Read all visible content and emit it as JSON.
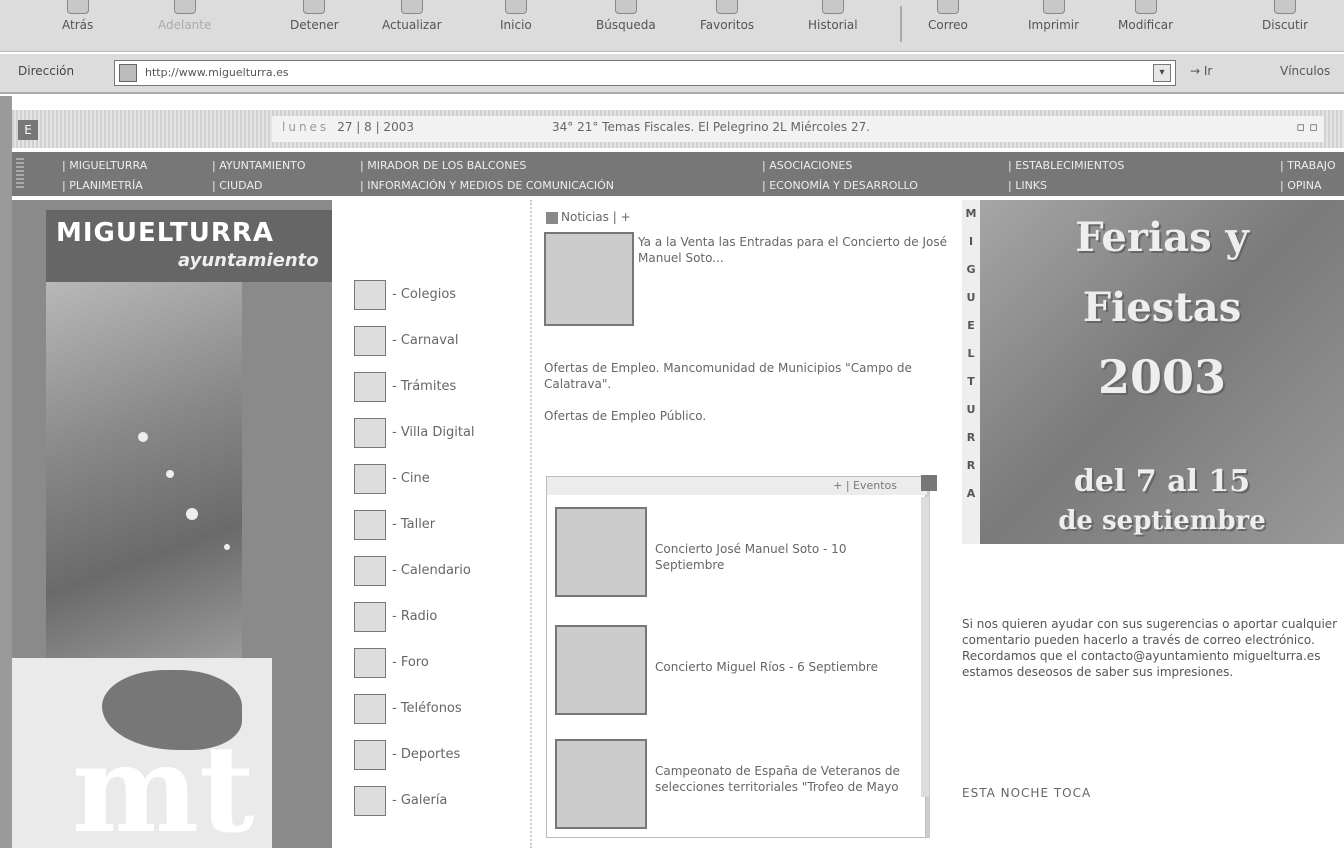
{
  "toolbar": {
    "buttons": [
      "Atrás",
      "Adelante",
      "Detener",
      "Actualizar",
      "Inicio",
      "Búsqueda",
      "Favoritos",
      "Historial",
      "Correo",
      "Imprimir",
      "Modificar",
      "Discutir"
    ]
  },
  "address": {
    "label": "Dirección",
    "url": "http://www.miguelturra.es",
    "go": "Ir",
    "links": "Vínculos"
  },
  "datebar": {
    "day": "lunes",
    "date": "27 | 8 | 2003",
    "weather": "34°  21°  Temas Fiscales. El Pelegrino 2L Miércoles 27."
  },
  "nav": {
    "row1": [
      "| MIGUELTURRA",
      "| AYUNTAMIENTO",
      "| MIRADOR DE LOS BALCONES",
      "| ASOCIACIONES",
      "| ESTABLECIMIENTOS",
      "| TRABAJO"
    ],
    "row2": [
      "| PLANIMETRÍA",
      "| CIUDAD",
      "| INFORMACIÓN Y MEDIOS DE COMUNICACIÓN",
      "| ECONOMÍA Y DESARROLLO",
      "| LINKS",
      "| OPINA"
    ]
  },
  "brand": {
    "name": "MIGUELTURRA",
    "sub": "ayuntamiento",
    "mark": "mt"
  },
  "menu": [
    "- Colegios",
    "- Carnaval",
    "- Trámites",
    "- Villa Digital",
    "- Cine",
    "- Taller",
    "- Calendario",
    "- Radio",
    "- Foro",
    "- Teléfonos",
    "- Deportes",
    "- Galería"
  ],
  "news": {
    "header": "Noticias | +",
    "items": [
      "Ya a la Venta las Entradas para el Concierto de José Manuel Soto...",
      "Ofertas de Empleo. Mancomunidad de Municipios \"Campo de Calatrava\".",
      "Ofertas de Empleo Público."
    ]
  },
  "events": {
    "header": "+ | Eventos",
    "items": [
      "Concierto José Manuel Soto - 10 Septiembre",
      "Concierto Miguel Ríos - 6 Septiembre",
      "Campeonato de España de Veteranos de selecciones territoriales \"Trofeo de Mayo"
    ]
  },
  "banner": {
    "vertical": [
      "M",
      "I",
      "G",
      "U",
      "E",
      "L",
      "T",
      "U",
      "R",
      "R",
      "A"
    ],
    "line1": "Ferias y",
    "line2": "Fiestas",
    "line3": "2003",
    "line4": "del 7 al 15",
    "line5": "de septiembre"
  },
  "aside": {
    "text": "Si nos quieren ayudar con sus sugerencias o aportar cualquier comentario pueden hacerlo a través de correo electrónico. Recordamos que el contacto@ayuntamiento miguelturra.es estamos deseosos de saber sus impresiones.",
    "tonight": "ESTA NOCHE TOCA"
  }
}
